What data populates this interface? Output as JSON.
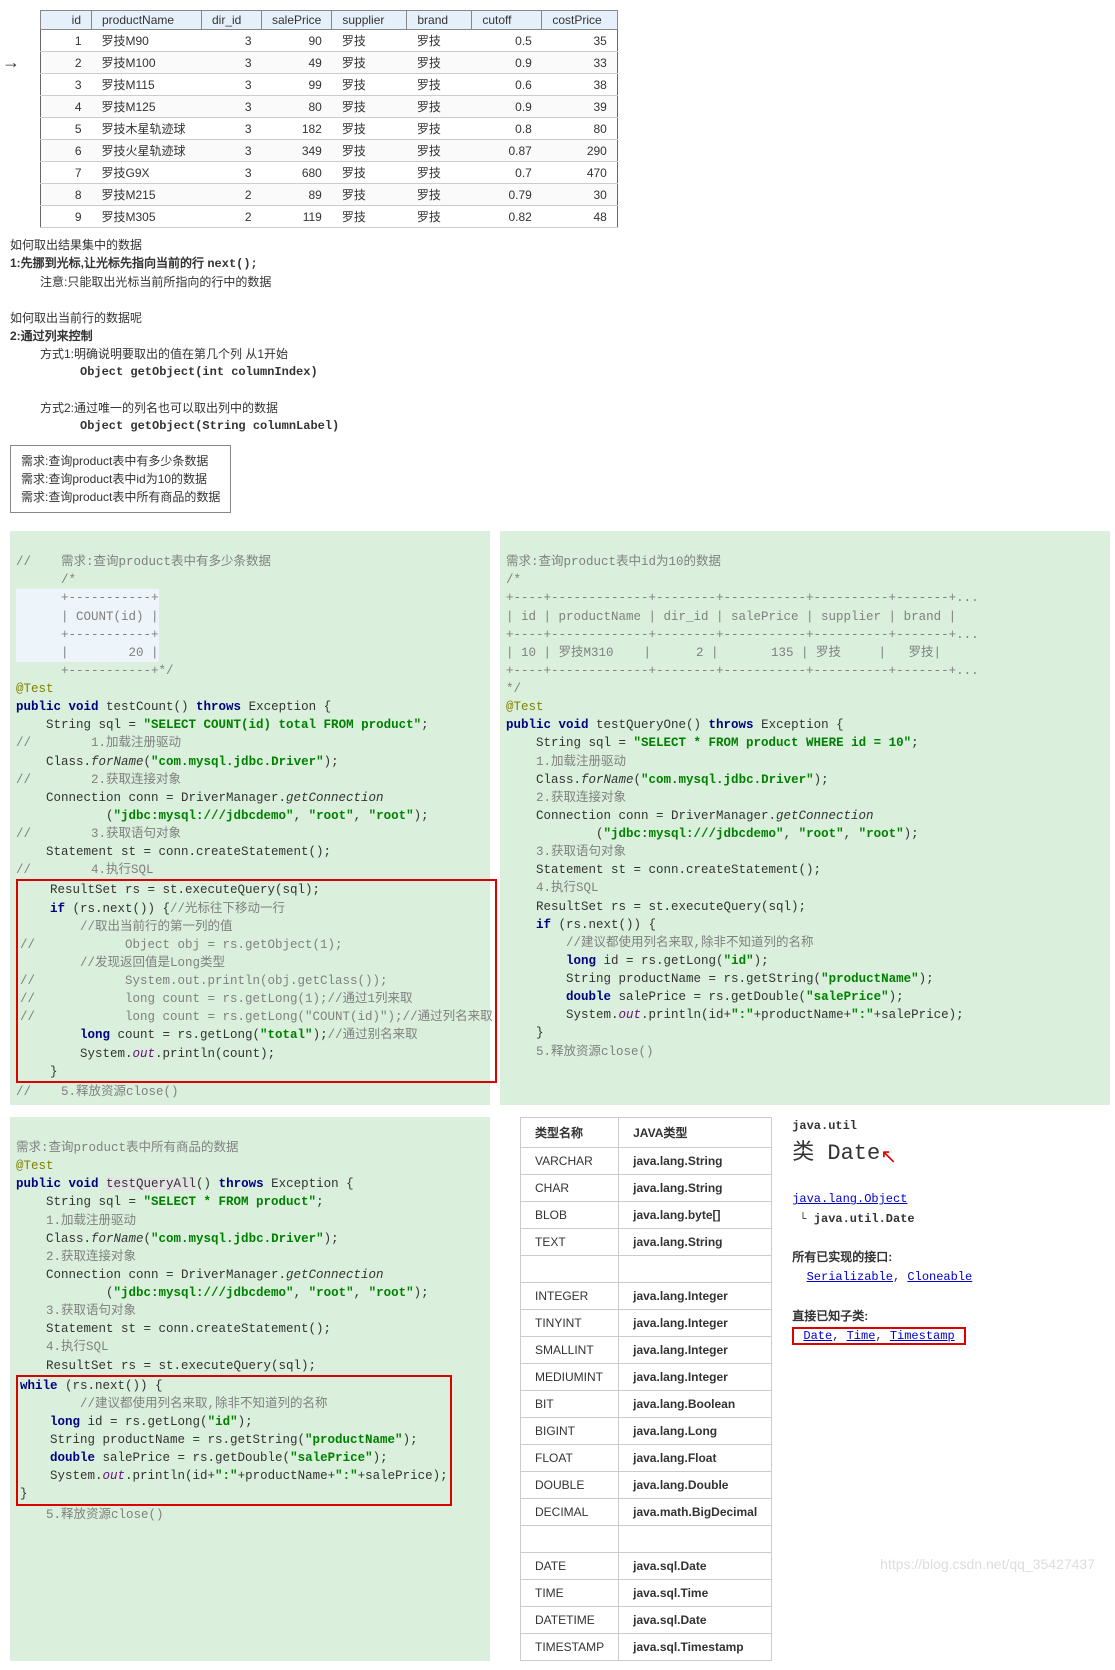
{
  "table": {
    "headers": [
      "id",
      "productName",
      "dir_id",
      "salePrice",
      "supplier",
      "brand",
      "cutoff",
      "costPrice"
    ],
    "rows": [
      [
        "1",
        "罗技M90",
        "3",
        "90",
        "罗技",
        "罗技",
        "0.5",
        "35"
      ],
      [
        "2",
        "罗技M100",
        "3",
        "49",
        "罗技",
        "罗技",
        "0.9",
        "33"
      ],
      [
        "3",
        "罗技M115",
        "3",
        "99",
        "罗技",
        "罗技",
        "0.6",
        "38"
      ],
      [
        "4",
        "罗技M125",
        "3",
        "80",
        "罗技",
        "罗技",
        "0.9",
        "39"
      ],
      [
        "5",
        "罗技木星轨迹球",
        "3",
        "182",
        "罗技",
        "罗技",
        "0.8",
        "80"
      ],
      [
        "6",
        "罗技火星轨迹球",
        "3",
        "349",
        "罗技",
        "罗技",
        "0.87",
        "290"
      ],
      [
        "7",
        "罗技G9X",
        "3",
        "680",
        "罗技",
        "罗技",
        "0.7",
        "470"
      ],
      [
        "8",
        "罗技M215",
        "2",
        "89",
        "罗技",
        "罗技",
        "0.79",
        "30"
      ],
      [
        "9",
        "罗技M305",
        "2",
        "119",
        "罗技",
        "罗技",
        "0.82",
        "48"
      ]
    ]
  },
  "notes": {
    "q1": "如何取出结果集中的数据",
    "a1a": "1:先挪到光标,让光标先指向当前的行 ",
    "a1a_mono": "next();",
    "a1b": "注意:只能取出光标当前所指向的行中的数据",
    "q2": "如何取出当前行的数据呢",
    "a2": "2:通过列来控制",
    "m1": "方式1:明确说明要取出的值在第几个列  从1开始",
    "m1_sig": "Object getObject(int columnIndex)",
    "m2": "方式2:通过唯一的列名也可以取出列中的数据",
    "m2_sig": "Object getObject(String columnLabel)"
  },
  "reqbox": {
    "r1": "需求:查询product表中有多少条数据",
    "r2": "需求:查询product表中id为10的数据",
    "r3": "需求:查询product表中所有商品的数据"
  },
  "block1": {
    "title_cmt": "//    需求:查询product表中有多少条数据",
    "hdr1": "      /*",
    "hdr2": "      +-----------+",
    "hdr3": "      | COUNT(id) |",
    "hdr4": "      +-----------+",
    "hdr5": "      |        20 |",
    "hdr6": "      +-----------+*/",
    "ann": "@Test",
    "sig_a": "public void",
    "sig_b": " testCount() ",
    "sig_c": "throws",
    "sig_d": " Exception {",
    "l1": "    String sql = ",
    "l1s": "\"SELECT COUNT(id) total FROM product\"",
    "c1": "//        1.加载注册驱动",
    "l2a": "    Class.",
    "l2b": "forName",
    "l2c": "(",
    "l2s": "\"com.mysql.jdbc.Driver\"",
    "l2d": ");",
    "c2": "//        2.获取连接对象",
    "l3": "    Connection conn = DriverManager.",
    "l3b": "getConnection",
    "l4": "            (",
    "l4s1": "\"jdbc:mysql:///jdbcdemo\"",
    "l4s2": "\"root\"",
    "l4s3": "\"root\"",
    "c3": "//        3.获取语句对象",
    "l5": "    Statement st = conn.createStatement();",
    "c4": "//        4.执行SQL",
    "rb1": "    ResultSet rs = st.executeQuery(sql);",
    "rb2a": "    if",
    "rb2b": " (rs.next()) {",
    "rb2c": "//光标往下移动一行",
    "rb3": "        //取出当前行的第一列的值",
    "rb4": "//            Object obj = rs.getObject(1);",
    "rb5": "        //发现返回值是Long类型",
    "rb6": "//            System.out.println(obj.getClass());",
    "rb7": "//            long count = rs.getLong(1);//通过1列来取",
    "rb8": "//            long count = rs.getLong(\"COUNT(id)\");//通过列名来取",
    "rb9a": "        long",
    "rb9b": " count = rs.getLong(",
    "rb9s": "\"total\"",
    "rb9c": ");",
    "rb9d": "//通过别名来取",
    "rb10": "        System.",
    "rb10b": "out",
    "rb10c": ".println(count);",
    "rb11": "    }",
    "c5": "//    5.释放资源close()"
  },
  "block2": {
    "title": "需求:查询product表中id为10的数据",
    "h0": "/*",
    "h1": "+----+-------------+--------+-----------+----------+-------+...",
    "h2": "| id | productName | dir_id | salePrice | supplier | brand |",
    "h3": "+----+-------------+--------+-----------+----------+-------+...",
    "h4": "| 10 | 罗技M310    |      2 |       135 | 罗技     |   罗技|",
    "h5": "+----+-------------+--------+-----------+----------+-------+...",
    "h6": "*/",
    "ann": "@Test",
    "sig": "public void testQueryOne() throws Exception {",
    "sql": "\"SELECT * FROM product WHERE id = 10\"",
    "c1": "1.加载注册驱动",
    "c2": "2.获取连接对象",
    "c3": "3.获取语句对象",
    "c4": "4.执行SQL",
    "l_if": "    if (rs.next()) {",
    "l_cmt": "        //建议都使用列名来取,除非不知道列的名称",
    "l_id": "        long id = rs.getLong(\"id\");",
    "l_pn": "        String productName = rs.getString(\"productName\");",
    "l_sp": "        double salePrice = rs.getDouble(\"salePrice\");",
    "l_out": "        System.out.println(id+\":\"+productName+\":\"+salePrice);",
    "c5": "5.释放资源close()"
  },
  "block3": {
    "title": "需求:查询product表中所有商品的数据",
    "ann": "@Test",
    "sig": "public void testQueryAll() throws Exception {",
    "sql": "\"SELECT * FROM product\"",
    "c1": "1.加载注册驱动",
    "c2": "2.获取连接对象",
    "c3": "3.获取语句对象",
    "c4": "4.执行SQL",
    "rb_w": "while (rs.next()) {",
    "rb_c": "    //建议都使用列名来取,除非不知道列的名称",
    "rb_id": "    long id = rs.getLong(\"id\");",
    "rb_pn": "    String productName = rs.getString(\"productName\");",
    "rb_sp": "    double salePrice = rs.getDouble(\"salePrice\");",
    "rb_out": "    System.out.println(id+\":\"+productName+\":\"+salePrice);",
    "c5": "5.释放资源close()"
  },
  "type_table": {
    "h1": "类型名称",
    "h2": "JAVA类型",
    "rows": [
      [
        "VARCHAR",
        "java.lang.String"
      ],
      [
        "CHAR",
        "java.lang.String"
      ],
      [
        "BLOB",
        "java.lang.byte[]"
      ],
      [
        "TEXT",
        "java.lang.String"
      ],
      [
        "",
        ""
      ],
      [
        "INTEGER",
        "java.lang.Integer"
      ],
      [
        "TINYINT",
        "java.lang.Integer"
      ],
      [
        "SMALLINT",
        "java.lang.Integer"
      ],
      [
        "MEDIUMINT",
        "java.lang.Integer"
      ],
      [
        "BIT",
        "java.lang.Boolean"
      ],
      [
        "BIGINT",
        "java.lang.Long"
      ],
      [
        "FLOAT",
        "java.lang.Float"
      ],
      [
        "DOUBLE",
        "java.lang.Double"
      ],
      [
        "DECIMAL",
        "java.math.BigDecimal"
      ],
      [
        "",
        ""
      ],
      [
        "DATE",
        "java.sql.Date"
      ],
      [
        "TIME",
        "java.sql.Time"
      ],
      [
        "DATETIME",
        "java.sql.Date"
      ],
      [
        "TIMESTAMP",
        "java.sql.Timestamp"
      ]
    ]
  },
  "javadoc": {
    "pkg": "java.util",
    "cls": "类 Date",
    "parent": "java.lang.Object",
    "self": "java.util.Date",
    "ifh": "所有已实现的接口:",
    "if1": "Serializable",
    "if2": "Cloneable",
    "sch": "直接已知子类:",
    "sc1": "Date",
    "sc2": "Time",
    "sc3": "Timestamp"
  },
  "watermark": "https://blog.csdn.net/qq_35427437"
}
